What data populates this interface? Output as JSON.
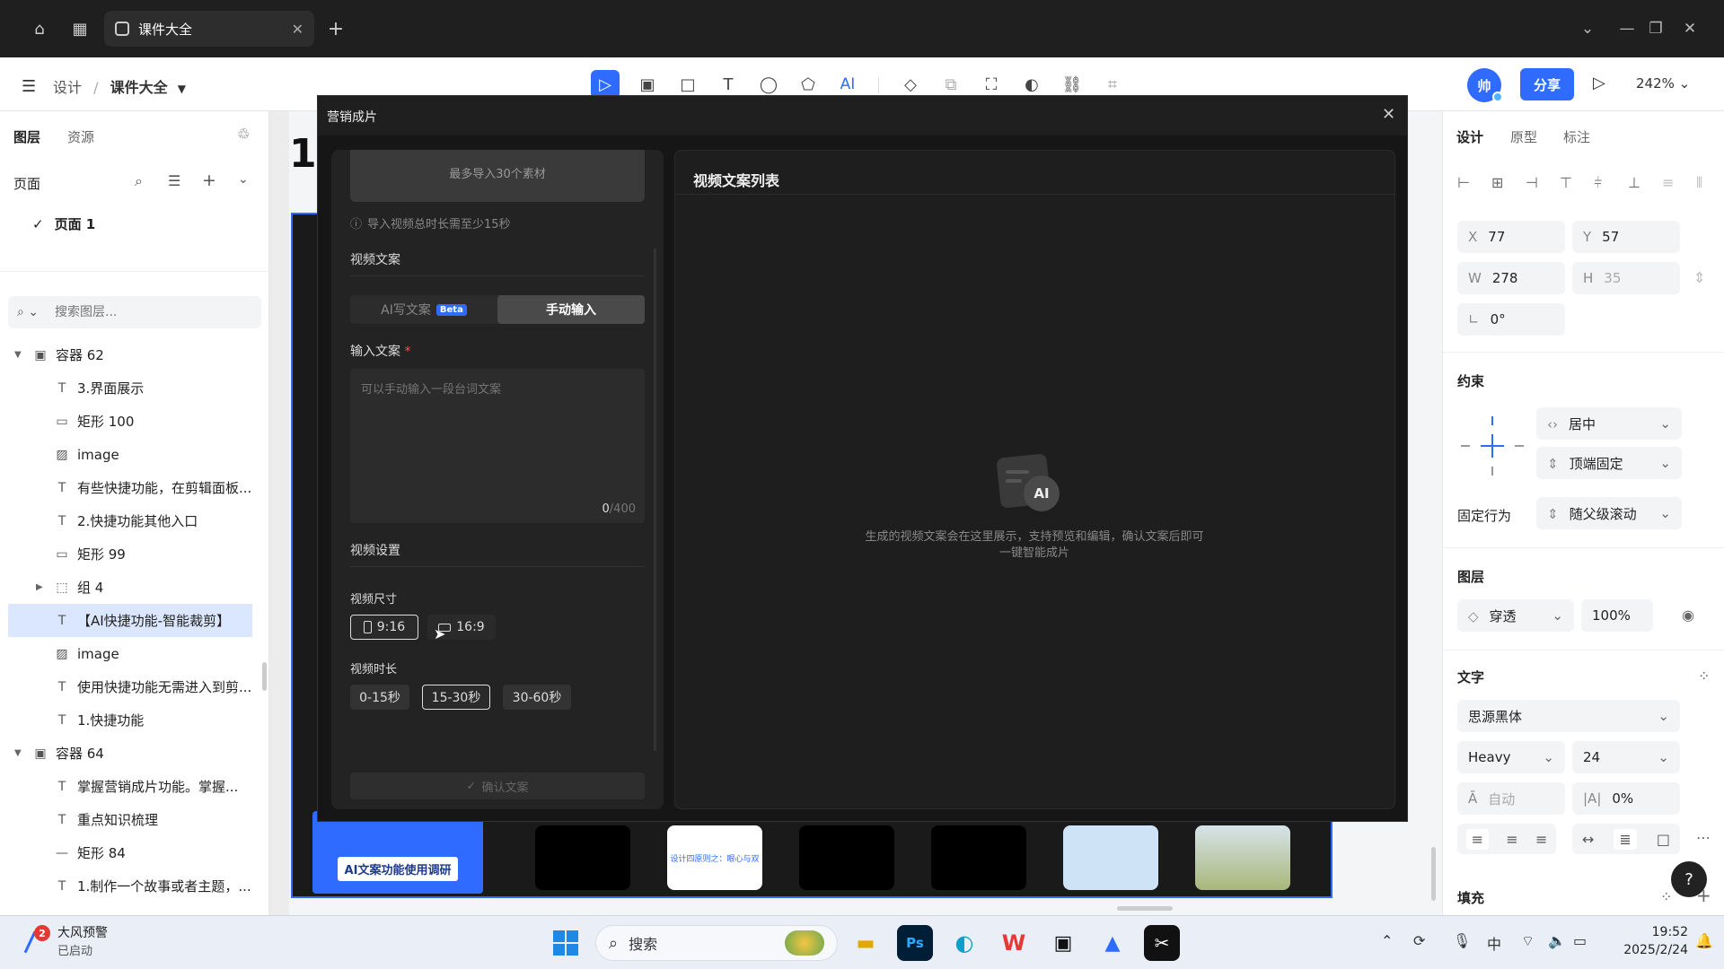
{
  "tab": {
    "title": "课件大全"
  },
  "breadcrumb": {
    "root": "设计",
    "separator": "/",
    "file": "课件大全"
  },
  "toolbar": {
    "share_label": "分享",
    "zoom": "242%",
    "avatar_char": "帅",
    "ai_label": "AI"
  },
  "left_panel": {
    "tabs": [
      "图层",
      "资源"
    ],
    "pages_label": "页面",
    "page_item": "页面 1",
    "search_placeholder": "搜索图层...",
    "layers": [
      {
        "name": "容器 62",
        "icon": "frame-icon",
        "indent": 0,
        "caret": true,
        "selected": false
      },
      {
        "name": "3.界面展示",
        "icon": "text-icon",
        "indent": 1,
        "caret": false,
        "selected": false
      },
      {
        "name": "矩形 100",
        "icon": "rectangle-icon",
        "indent": 1,
        "caret": false,
        "selected": false
      },
      {
        "name": "image",
        "icon": "image-icon",
        "indent": 1,
        "caret": false,
        "selected": false
      },
      {
        "name": "有些快捷功能，在剪辑面板...",
        "icon": "text-icon",
        "indent": 1,
        "caret": false,
        "selected": false
      },
      {
        "name": "2.快捷功能其他入口",
        "icon": "text-icon",
        "indent": 1,
        "caret": false,
        "selected": false
      },
      {
        "name": "矩形 99",
        "icon": "rectangle-icon",
        "indent": 1,
        "caret": false,
        "selected": false
      },
      {
        "name": "组 4",
        "icon": "group-icon",
        "indent": 1,
        "caret": true,
        "selected": false
      },
      {
        "name": "【AI快捷功能-智能裁剪】",
        "icon": "text-icon",
        "indent": 1,
        "caret": false,
        "selected": true
      },
      {
        "name": "image",
        "icon": "image-icon",
        "indent": 1,
        "caret": false,
        "selected": false
      },
      {
        "name": "使用快捷功能无需进入到剪...",
        "icon": "text-icon",
        "indent": 1,
        "caret": false,
        "selected": false
      },
      {
        "name": "1.快捷功能",
        "icon": "text-icon",
        "indent": 1,
        "caret": false,
        "selected": false
      },
      {
        "name": "容器 64",
        "icon": "frame-icon",
        "indent": 0,
        "caret": true,
        "selected": false
      },
      {
        "name": "掌握营销成片功能。掌握...",
        "icon": "text-icon",
        "indent": 1,
        "caret": false,
        "selected": false
      },
      {
        "name": "重点知识梳理",
        "icon": "text-icon",
        "indent": 1,
        "caret": false,
        "selected": false
      },
      {
        "name": "矩形 84",
        "icon": "line-icon",
        "indent": 1,
        "caret": false,
        "selected": false
      },
      {
        "name": "1.制作一个故事或者主题，...",
        "icon": "text-icon",
        "indent": 1,
        "caret": false,
        "selected": false
      }
    ]
  },
  "canvas": {
    "heading_fragment": "1.",
    "thumb_banner": "AI文案功能使用调研",
    "thumb_text": "设计四原则之：眼心与双"
  },
  "dialog": {
    "title": "营销成片",
    "import_hint": "最多导入30个素材",
    "duration_note": "导入视频总时长需至少15秒",
    "copy_section": "视频文案",
    "tab_ai": "AI写文案",
    "tab_ai_badge": "Beta",
    "tab_manual": "手动输入",
    "input_label": "输入文案",
    "required_mark": "*",
    "input_placeholder": "可以手动输入一段台词文案",
    "char_count": "0",
    "char_max": "/400",
    "settings_section": "视频设置",
    "size_label": "视频尺寸",
    "sizes": [
      "9:16",
      "16:9"
    ],
    "length_label": "视频时长",
    "lengths": [
      "0-15秒",
      "15-30秒",
      "30-60秒"
    ],
    "confirm_label": "确认文案",
    "list_title": "视频文案列表",
    "empty_line1": "生成的视频文案会在这里展示，支持预览和编辑，确认文案后即可",
    "empty_line2": "一键智能成片",
    "ai_logo": "AI"
  },
  "right_panel": {
    "tabs": [
      "设计",
      "原型",
      "标注"
    ],
    "x_key": "X",
    "x_val": "77",
    "y_key": "Y",
    "y_val": "57",
    "w_key": "W",
    "w_val": "278",
    "h_key": "H",
    "h_val": "35",
    "rotation": "0°",
    "constraints_title": "约束",
    "constraint_h": "居中",
    "constraint_v": "顶端固定",
    "fixed_label": "固定行为",
    "fixed_val": "随父级滚动",
    "layer_title": "图层",
    "blend": "穿透",
    "opacity": "100%",
    "text_title": "文字",
    "font": "思源黑体",
    "weight": "Heavy",
    "size": "24",
    "line_height": "自动",
    "letter_spacing": "0%",
    "fill_title": "填充",
    "help": "?"
  },
  "taskbar": {
    "notify_title": "大风预警",
    "notify_sub": "已启动",
    "notify_badge": "2",
    "search_label": "搜索",
    "ime": "中",
    "time": "19:52",
    "date": "2025/2/24",
    "ps_label": "Ps"
  }
}
